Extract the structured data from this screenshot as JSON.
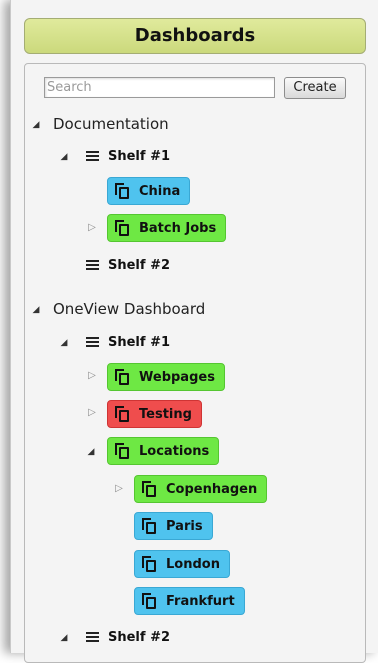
{
  "header": {
    "title": "Dashboards"
  },
  "search": {
    "placeholder": "Search",
    "value": ""
  },
  "toolbar": {
    "create_label": "Create"
  },
  "tree": {
    "sections": [
      {
        "label": "Documentation",
        "expanded": true,
        "shelves": [
          {
            "label": "Shelf #1",
            "expanded": true,
            "dashboards": [
              {
                "label": "China",
                "color": "#4fc3ee",
                "has_children": false
              },
              {
                "label": "Batch Jobs",
                "color": "#6ee844",
                "has_children": true,
                "expanded": false
              }
            ]
          },
          {
            "label": "Shelf #2",
            "expanded": false,
            "dashboards": []
          }
        ]
      },
      {
        "label": "OneView Dashboard",
        "expanded": true,
        "shelves": [
          {
            "label": "Shelf #1",
            "expanded": true,
            "dashboards": [
              {
                "label": "Webpages",
                "color": "#6ee844",
                "has_children": true,
                "expanded": false
              },
              {
                "label": "Testing",
                "color": "#ef4d4d",
                "has_children": true,
                "expanded": false
              },
              {
                "label": "Locations",
                "color": "#6ee844",
                "has_children": true,
                "expanded": true,
                "children": [
                  {
                    "label": "Copenhagen",
                    "color": "#6ee844",
                    "has_children": true,
                    "expanded": false
                  },
                  {
                    "label": "Paris",
                    "color": "#4fc3ee",
                    "has_children": false
                  },
                  {
                    "label": "London",
                    "color": "#4fc3ee",
                    "has_children": false
                  },
                  {
                    "label": "Frankfurt",
                    "color": "#4fc3ee",
                    "has_children": false
                  }
                ]
              }
            ]
          },
          {
            "label": "Shelf #2",
            "expanded": true,
            "dashboards": []
          }
        ]
      }
    ]
  },
  "colors": {
    "header_bg": "#d6e28a",
    "status_ok": "#6ee844",
    "status_info": "#4fc3ee",
    "status_error": "#ef4d4d"
  },
  "icons": {
    "expanded": "triangle-down",
    "collapsed": "triangle-right",
    "shelf": "menu-lines",
    "dashboard": "copy"
  }
}
